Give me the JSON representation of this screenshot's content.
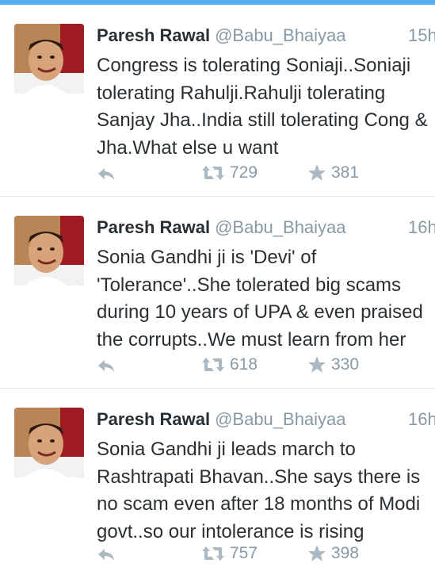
{
  "colors": {
    "accent": "#55acee",
    "name": "#292f33",
    "muted": "#8899a6",
    "icon": "#aab8c2",
    "divider": "#e1e8ed"
  },
  "tweets": [
    {
      "name": "Paresh Rawal",
      "handle": "@Babu_Bhaiyaa",
      "time": "15h",
      "text": "Congress is tolerating Soniaji..Soniaji tolerating Rahulji.Rahulji tolerating Sanjay Jha..India still tolerating Cong & Jha.What else u want",
      "retweets": "729",
      "favorites": "381"
    },
    {
      "name": "Paresh Rawal",
      "handle": "@Babu_Bhaiyaa",
      "time": "16h",
      "text": "Sonia Gandhi ji is 'Devi' of 'Tolerance'..She tolerated big scams during 10 years of UPA & even praised the corrupts..We must learn from her",
      "retweets": "618",
      "favorites": "330"
    },
    {
      "name": "Paresh Rawal",
      "handle": "@Babu_Bhaiyaa",
      "time": "16h",
      "text": "Sonia Gandhi ji leads march to Rashtrapati Bhavan..She says there is no scam even after 18 months of Modi govt..so our intolerance is rising",
      "retweets": "757",
      "favorites": "398"
    }
  ],
  "icons": {
    "reply": "reply-icon",
    "retweet": "retweet-icon",
    "favorite": "star-icon",
    "avatar": "avatar"
  }
}
